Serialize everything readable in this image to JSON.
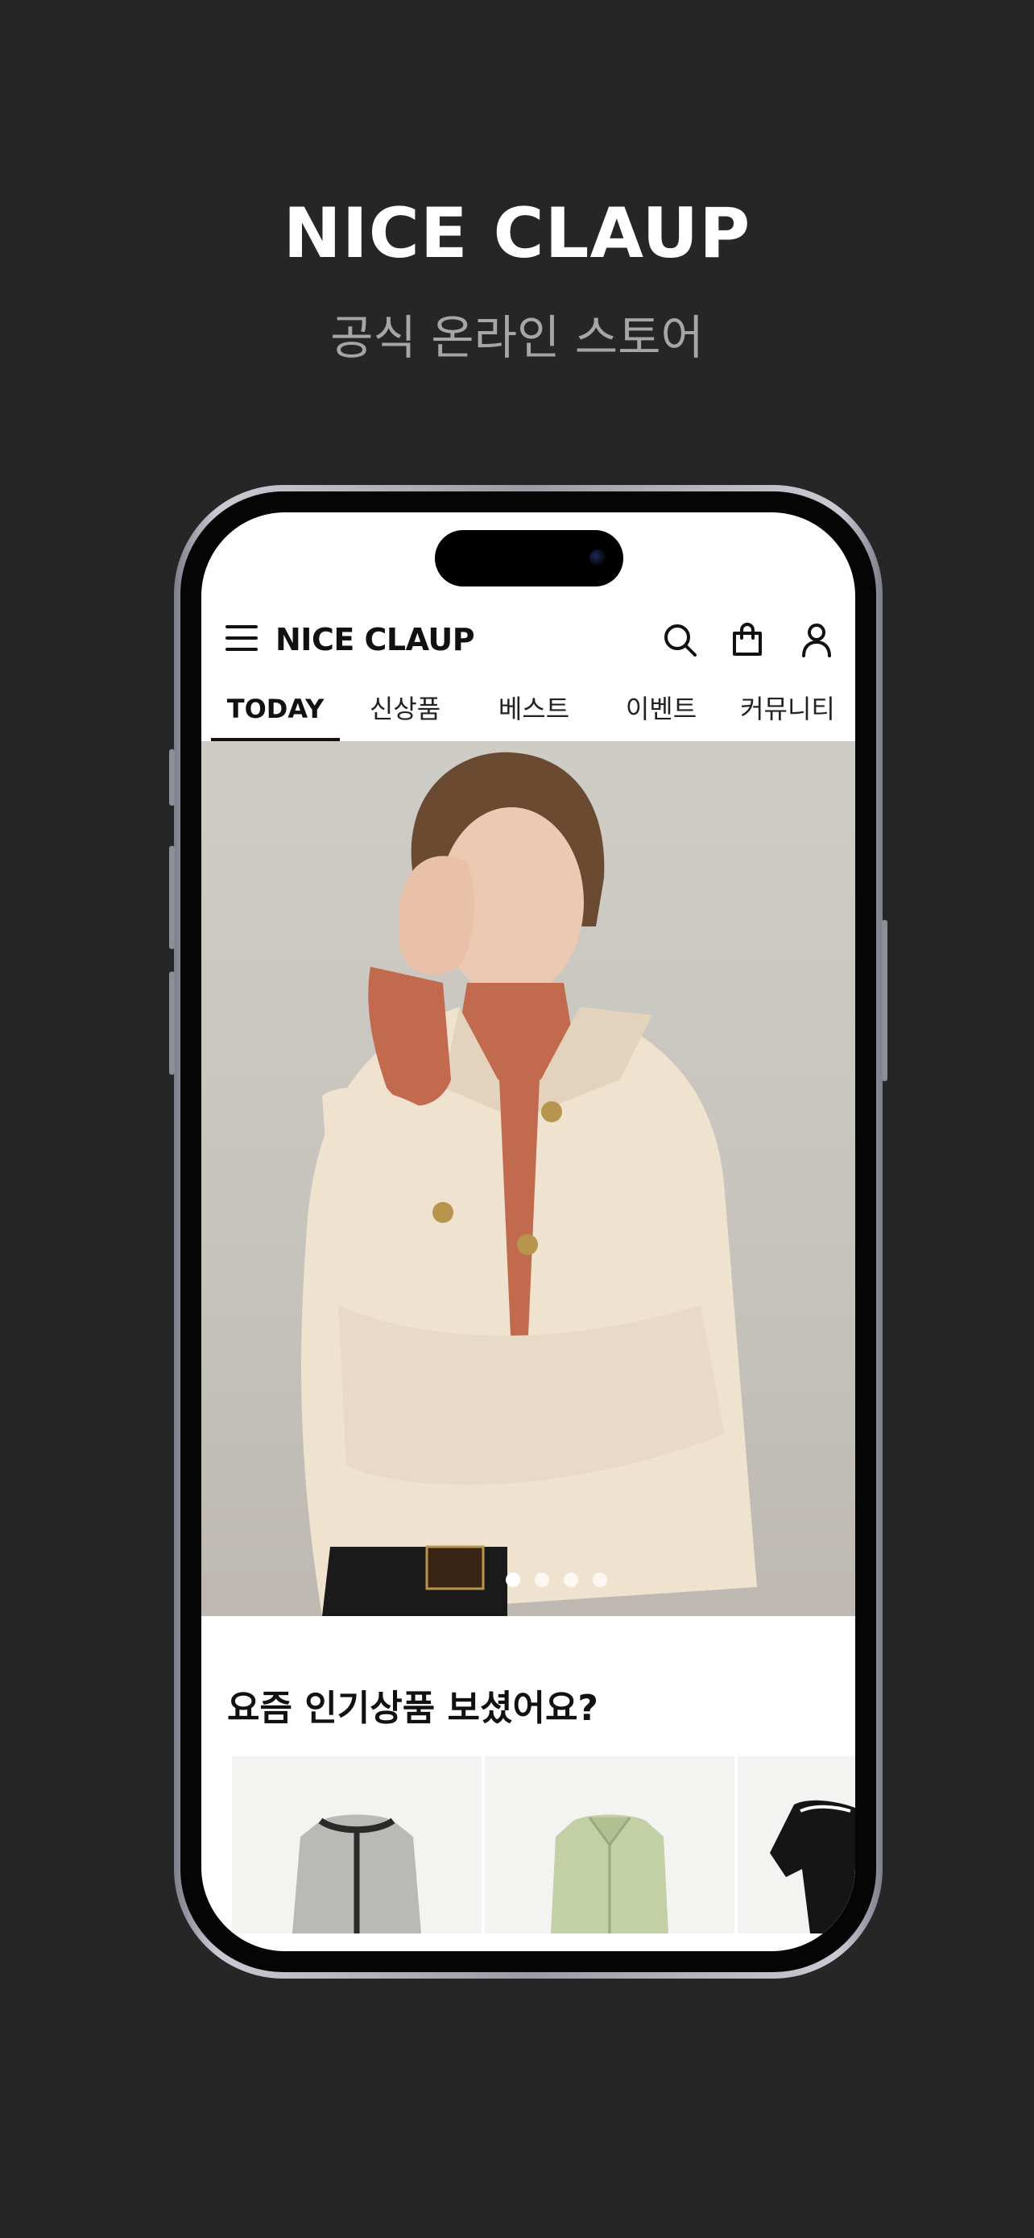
{
  "promo": {
    "title": "NICE CLAUP",
    "subtitle": "공식 온라인 스토어"
  },
  "app": {
    "brand": "NICE CLAUP",
    "header_icons": [
      "menu-icon",
      "search-icon",
      "shopping-bag-icon",
      "user-icon"
    ],
    "tabs": [
      {
        "label": "TODAY",
        "active": true
      },
      {
        "label": "신상품",
        "active": false
      },
      {
        "label": "베스트",
        "active": false
      },
      {
        "label": "이벤트",
        "active": false
      },
      {
        "label": "커뮤니티",
        "active": false
      }
    ],
    "hero": {
      "carousel_slides": 4,
      "active_slide": 1
    },
    "popular_section": {
      "title": "요즘 인기상품 보셨어요?"
    }
  },
  "colors": {
    "background": "#262626",
    "text_primary": "#111111",
    "subtitle": "#a6a6a6"
  }
}
